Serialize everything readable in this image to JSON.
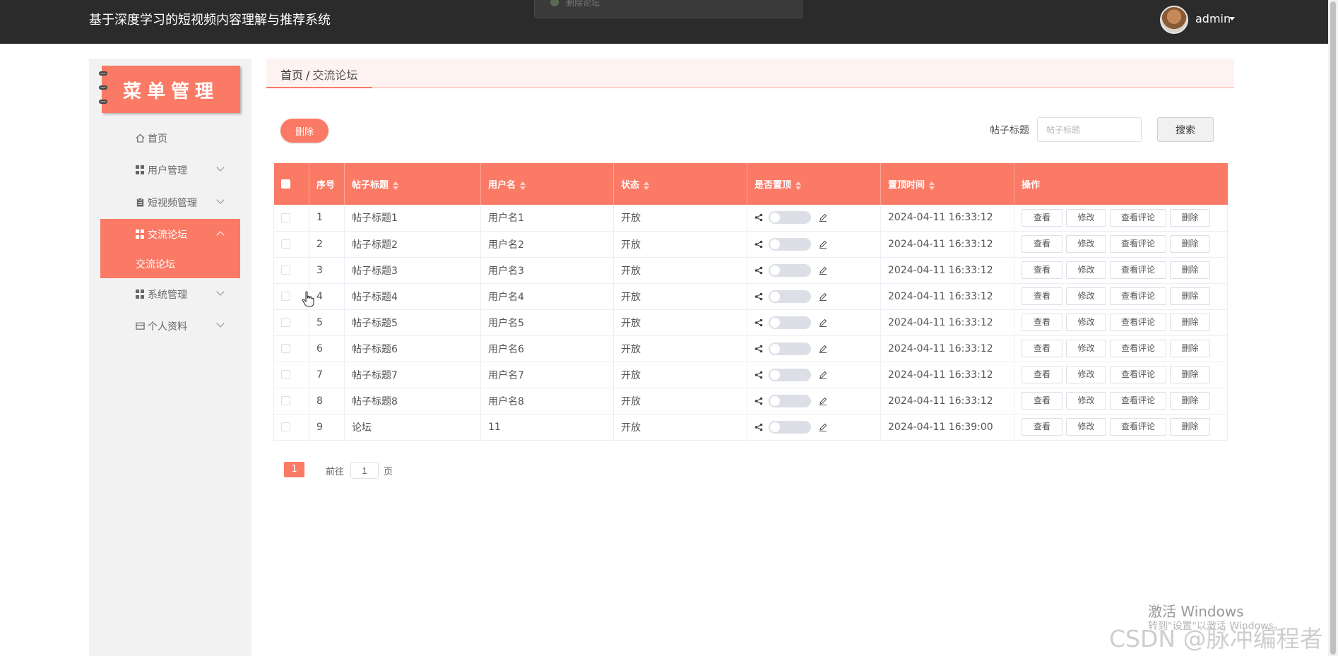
{
  "app": {
    "title": "基于深度学习的短视频内容理解与推荐系统",
    "toast": "删除论坛",
    "user": "admin"
  },
  "sidebar": {
    "logo_text": "菜单管理",
    "items": [
      {
        "label": "首页",
        "icon": "home-icon"
      },
      {
        "label": "用户管理",
        "icon": "grid-icon"
      },
      {
        "label": "短视频管理",
        "icon": "clipboard-icon"
      },
      {
        "label": "交流论坛",
        "icon": "grid-icon",
        "active": true
      },
      {
        "label": "系统管理",
        "icon": "grid-icon"
      },
      {
        "label": "个人资料",
        "icon": "card-icon"
      }
    ],
    "submenu": {
      "label": "交流论坛"
    }
  },
  "breadcrumb": {
    "home": "首页",
    "sep": "/",
    "current": "交流论坛"
  },
  "toolbar": {
    "delete_label": "删除",
    "search_label": "帖子标题",
    "search_placeholder": "帖子标题",
    "search_button": "搜索"
  },
  "table": {
    "headers": [
      "序号",
      "帖子标题",
      "用户名",
      "状态",
      "是否置顶",
      "置顶时间",
      "操作"
    ],
    "actions": [
      "查看",
      "修改",
      "查看评论",
      "删除"
    ],
    "rows": [
      {
        "index": "1",
        "title": "帖子标题1",
        "user": "用户名1",
        "status": "开放",
        "time": "2024-04-11 16:33:12"
      },
      {
        "index": "2",
        "title": "帖子标题2",
        "user": "用户名2",
        "status": "开放",
        "time": "2024-04-11 16:33:12"
      },
      {
        "index": "3",
        "title": "帖子标题3",
        "user": "用户名3",
        "status": "开放",
        "time": "2024-04-11 16:33:12"
      },
      {
        "index": "4",
        "title": "帖子标题4",
        "user": "用户名4",
        "status": "开放",
        "time": "2024-04-11 16:33:12"
      },
      {
        "index": "5",
        "title": "帖子标题5",
        "user": "用户名5",
        "status": "开放",
        "time": "2024-04-11 16:33:12"
      },
      {
        "index": "6",
        "title": "帖子标题6",
        "user": "用户名6",
        "status": "开放",
        "time": "2024-04-11 16:33:12"
      },
      {
        "index": "7",
        "title": "帖子标题7",
        "user": "用户名7",
        "status": "开放",
        "time": "2024-04-11 16:33:12"
      },
      {
        "index": "8",
        "title": "帖子标题8",
        "user": "用户名8",
        "status": "开放",
        "time": "2024-04-11 16:33:12"
      },
      {
        "index": "9",
        "title": "论坛",
        "user": "11",
        "status": "开放",
        "time": "2024-04-11 16:39:00"
      }
    ]
  },
  "pagination": {
    "current": "1",
    "goto_label": "前往",
    "goto_value": "1",
    "suffix": "页"
  },
  "watermarks": {
    "windows": "激活 Windows",
    "windows_sub": "转到\"设置\"以激活 Windows。",
    "csdn": "CSDN @脉冲编程者"
  },
  "colors": {
    "accent": "#fb7a65",
    "topbar": "#2b2b2b"
  }
}
